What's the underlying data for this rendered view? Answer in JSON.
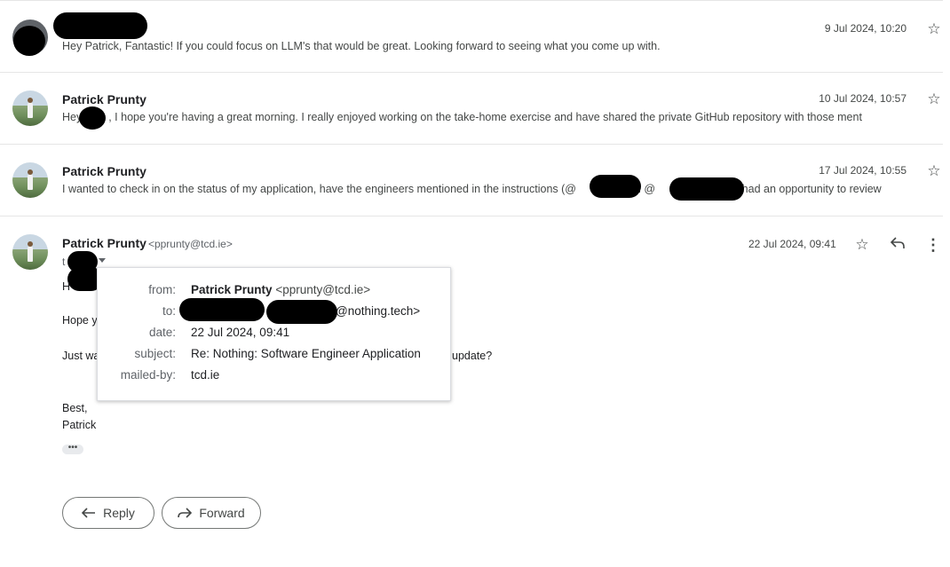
{
  "messages": [
    {
      "sender": "",
      "snippet": "Hey Patrick, Fantastic! If you could focus on LLM's that would be great. Looking forward to seeing what you come up with.",
      "date": "9 Jul 2024, 10:20"
    },
    {
      "sender": "Patrick Prunty",
      "snippet_before": "Hey",
      "snippet_after": ", I hope you're having a great morning. I really enjoyed working on the take-home exercise and have shared the private GitHub repository with those ment",
      "date": "10 Jul 2024, 10:57"
    },
    {
      "sender": "Patrick Prunty",
      "snippet_before": "I wanted to check in on the status of my application, have the engineers mentioned in the instructions (@",
      "snippet_mid": "and @",
      "snippet_after": ") had an opportunity to review",
      "date": "17 Jul 2024, 10:55"
    }
  ],
  "open_message": {
    "sender": "Patrick Prunty",
    "sender_email": "<pprunty@tcd.ie>",
    "date": "22 Jul 2024, 09:41",
    "to_prefix": "t",
    "body": {
      "line1_prefix": "H",
      "line2_prefix": "Hope y",
      "line3_prefix": "Just wa",
      "line3_suffix": "update?",
      "signoff": "Best,",
      "signature": "Patrick"
    }
  },
  "details_popup": {
    "from_label": "from:",
    "from_name": "Patrick Prunty",
    "from_email": "<pprunty@tcd.ie>",
    "to_label": "to:",
    "to_suffix": "@nothing.tech>",
    "date_label": "date:",
    "date_value": "22 Jul 2024, 09:41",
    "subject_label": "subject:",
    "subject_value": "Re: Nothing: Software Engineer Application",
    "mailed_by_label": "mailed-by:",
    "mailed_by_value": "tcd.ie"
  },
  "actions": {
    "reply_label": "Reply",
    "forward_label": "Forward"
  },
  "icons": {
    "star": "star-outline-icon",
    "reply": "reply-arrow-icon",
    "more": "more-vertical-icon"
  }
}
